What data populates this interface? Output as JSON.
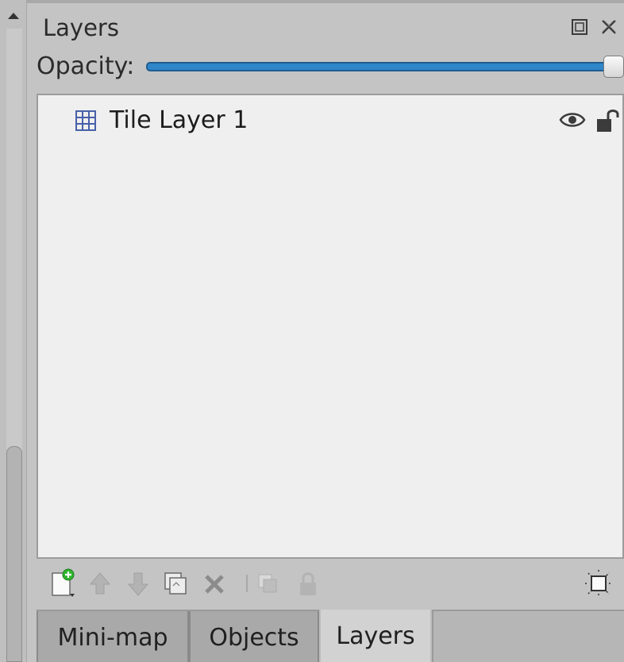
{
  "dock": {
    "title": "Layers",
    "float_icon": "float-icon",
    "close_icon": "close-icon"
  },
  "opacity": {
    "label": "Opacity:",
    "value": 1.0
  },
  "layers": [
    {
      "name": "Tile Layer 1",
      "type_icon": "tile-layer-icon",
      "visible": true,
      "locked": false
    }
  ],
  "toolbar": {
    "buttons": [
      {
        "icon": "add-layer-icon",
        "enabled": true
      },
      {
        "icon": "arrow-up-icon",
        "enabled": false
      },
      {
        "icon": "arrow-down-icon",
        "enabled": false
      },
      {
        "icon": "duplicate-layer-icon",
        "enabled": true
      },
      {
        "icon": "delete-icon",
        "enabled": true
      },
      {
        "icon": "merge-down-icon",
        "enabled": false
      },
      {
        "icon": "lock-icon",
        "enabled": false
      },
      {
        "icon": "highlight-layer-icon",
        "enabled": true
      }
    ]
  },
  "tabs": [
    {
      "label": "Mini-map",
      "active": false
    },
    {
      "label": "Objects",
      "active": false
    },
    {
      "label": "Layers",
      "active": true
    }
  ],
  "colors": {
    "slider_fill": "#2f86c9",
    "list_bg": "#efefef",
    "panel_bg": "#c4c4c4",
    "add_badge": "#2fb52f"
  }
}
